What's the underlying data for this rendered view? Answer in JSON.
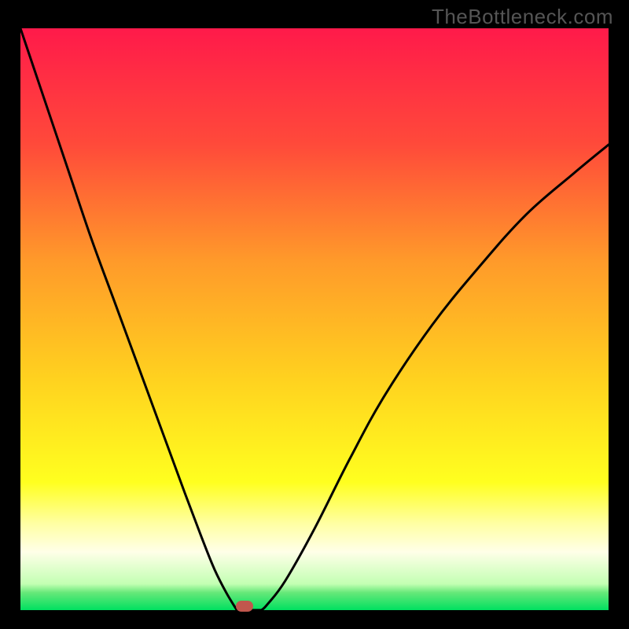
{
  "watermark": "TheBottleneck.com",
  "marker": {
    "x_frac": 0.381,
    "y_frac": 0.998,
    "color": "#c1574d"
  },
  "chart_data": {
    "type": "line",
    "title": "",
    "xlabel": "",
    "ylabel": "",
    "xlim": [
      0,
      1
    ],
    "ylim": [
      0,
      1
    ],
    "background_gradient": {
      "stops": [
        {
          "offset": 0.0,
          "color": "#ff1a4a"
        },
        {
          "offset": 0.2,
          "color": "#ff4a3a"
        },
        {
          "offset": 0.4,
          "color": "#ff9a2a"
        },
        {
          "offset": 0.6,
          "color": "#ffd11f"
        },
        {
          "offset": 0.78,
          "color": "#ffff1f"
        },
        {
          "offset": 0.85,
          "color": "#ffffa1"
        },
        {
          "offset": 0.9,
          "color": "#ffffe8"
        },
        {
          "offset": 0.955,
          "color": "#c3ffb3"
        },
        {
          "offset": 0.97,
          "color": "#66e879"
        },
        {
          "offset": 1.0,
          "color": "#00e060"
        }
      ]
    },
    "series": [
      {
        "name": "bottleneck-curve",
        "x": [
          0.0,
          0.04,
          0.08,
          0.12,
          0.16,
          0.2,
          0.24,
          0.28,
          0.31,
          0.33,
          0.35,
          0.37,
          0.378,
          0.41,
          0.42,
          0.45,
          0.5,
          0.56,
          0.62,
          0.7,
          0.78,
          0.86,
          0.94,
          1.0
        ],
        "y": [
          1.0,
          0.88,
          0.76,
          0.64,
          0.53,
          0.42,
          0.31,
          0.2,
          0.12,
          0.07,
          0.03,
          0.005,
          0.0,
          0.0,
          0.01,
          0.05,
          0.14,
          0.26,
          0.37,
          0.49,
          0.59,
          0.68,
          0.75,
          0.8
        ]
      }
    ],
    "flat_segment": {
      "x0": 0.368,
      "x1": 0.41,
      "y": 0.0
    }
  }
}
